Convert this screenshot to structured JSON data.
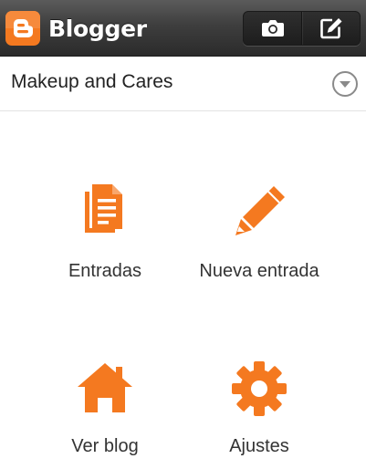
{
  "header": {
    "app_name": "Blogger",
    "logo_icon": "blogger-logo-icon",
    "actions": [
      {
        "icon": "camera-icon"
      },
      {
        "icon": "compose-icon"
      }
    ]
  },
  "blog_selector": {
    "selected_blog": "Makeup and Cares",
    "icon": "chevron-down-circle-icon"
  },
  "actions": [
    {
      "label": "Entradas",
      "icon": "posts-icon"
    },
    {
      "label": "Nueva entrada",
      "icon": "pencil-icon"
    },
    {
      "label": "Ver blog",
      "icon": "home-icon"
    },
    {
      "label": "Ajustes",
      "icon": "gear-icon"
    }
  ],
  "colors": {
    "accent": "#f47920",
    "topbar": "#3a3a3a",
    "text": "#333333"
  }
}
